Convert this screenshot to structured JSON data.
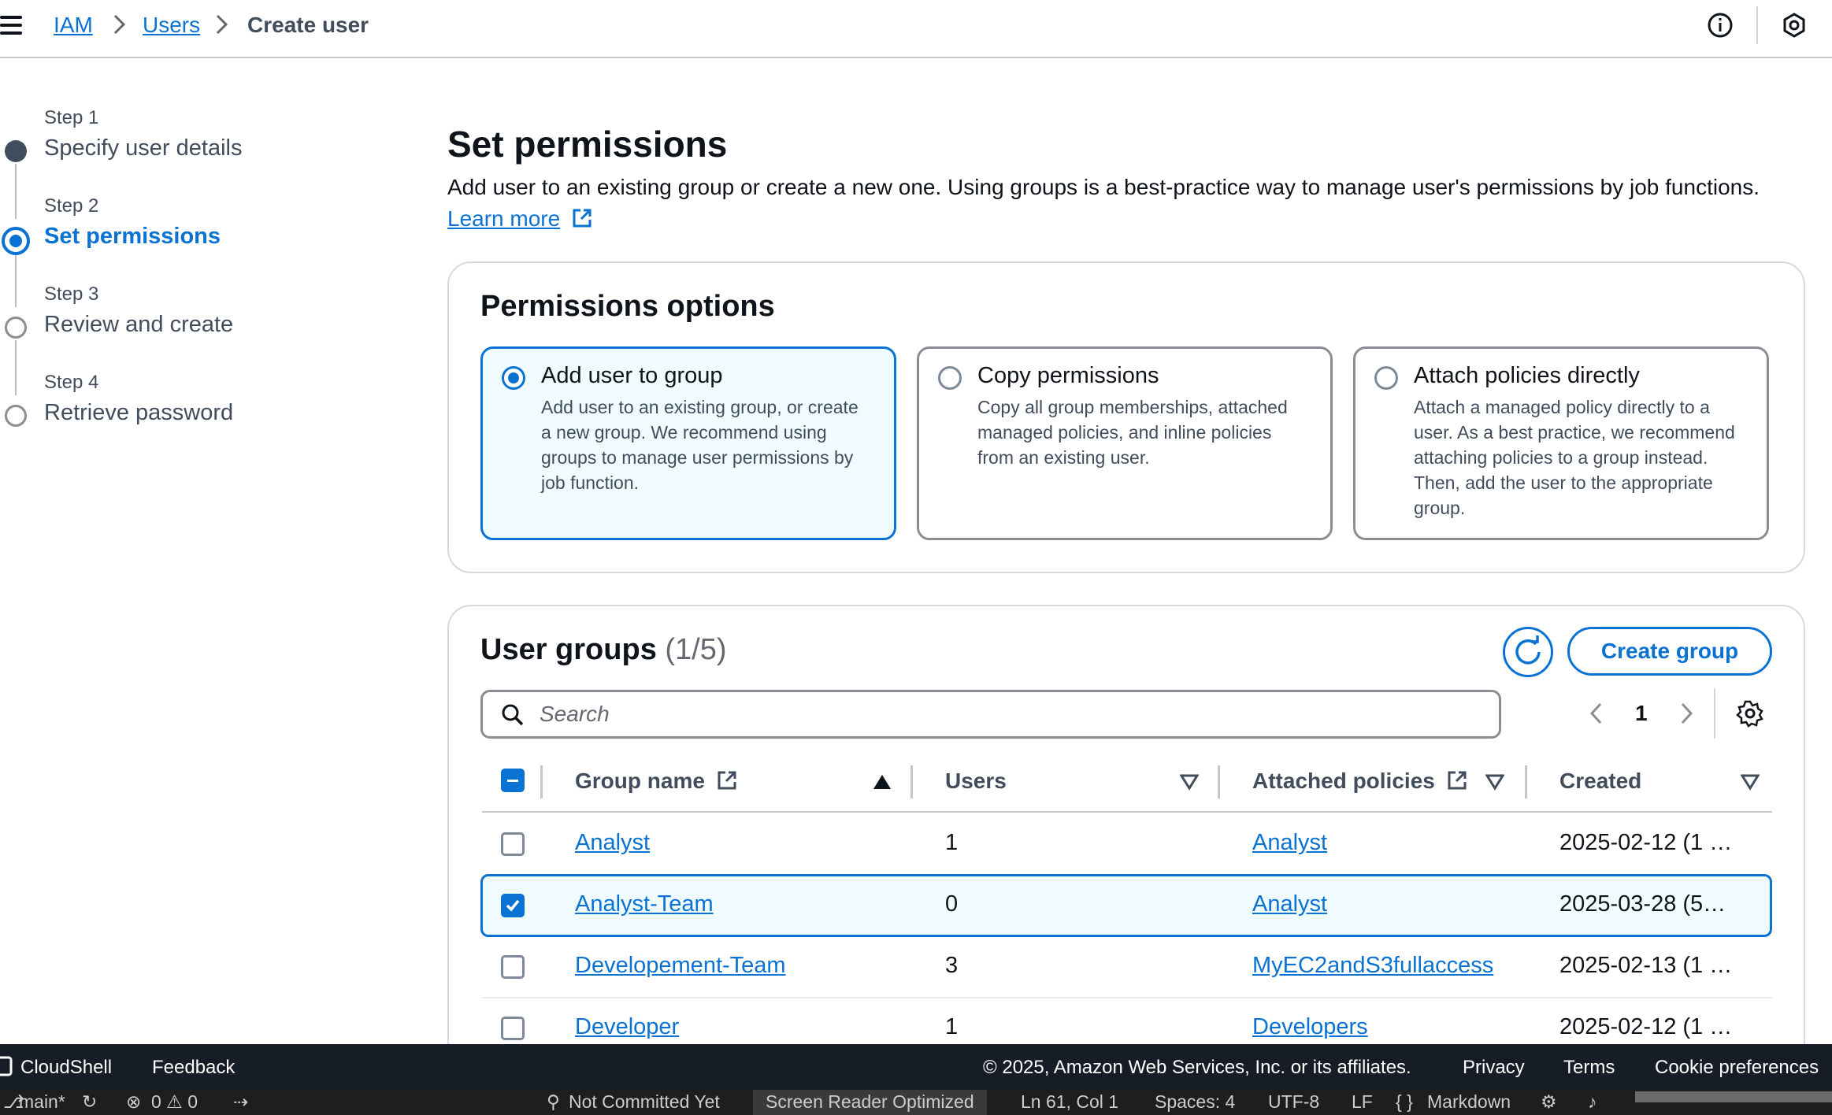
{
  "breadcrumb": {
    "items": [
      "IAM",
      "Users",
      "Create user"
    ]
  },
  "steps": [
    {
      "step": "Step 1",
      "label": "Specify user details"
    },
    {
      "step": "Step 2",
      "label": "Set permissions"
    },
    {
      "step": "Step 3",
      "label": "Review and create"
    },
    {
      "step": "Step 4",
      "label": "Retrieve password"
    }
  ],
  "page": {
    "title": "Set permissions",
    "description": "Add user to an existing group or create a new one. Using groups is a best-practice way to manage user's permissions by job functions.",
    "learn_more": "Learn more"
  },
  "permissions": {
    "title": "Permissions options",
    "options": [
      {
        "title": "Add user to group",
        "desc": "Add user to an existing group, or create a new group. We recommend using groups to manage user permissions by job function.",
        "selected": true
      },
      {
        "title": "Copy permissions",
        "desc": "Copy all group memberships, attached managed policies, and inline policies from an existing user.",
        "selected": false
      },
      {
        "title": "Attach policies directly",
        "desc": "Attach a managed policy directly to a user. As a best practice, we recommend attaching policies to a group instead. Then, add the user to the appropriate group.",
        "selected": false
      }
    ]
  },
  "groups": {
    "title": "User groups",
    "count": "(1/5)",
    "create_label": "Create group",
    "search_placeholder": "Search",
    "page_number": "1",
    "columns": [
      "Group name",
      "Users",
      "Attached policies",
      "Created"
    ],
    "rows": [
      {
        "name": "Analyst",
        "users": "1",
        "policies": "Analyst",
        "created": "2025-02-12 (1 …",
        "checked": false
      },
      {
        "name": "Analyst-Team",
        "users": "0",
        "policies": "Analyst",
        "created": "2025-03-28 (5…",
        "checked": true
      },
      {
        "name": "Developement-Team",
        "users": "3",
        "policies": "MyEC2andS3fullaccess",
        "created": "2025-02-13 (1 …",
        "checked": false
      },
      {
        "name": "Developer",
        "users": "1",
        "policies": "Developers",
        "created": "2025-02-12 (1 …",
        "checked": false
      }
    ]
  },
  "footer": {
    "cloudshell": "CloudShell",
    "feedback": "Feedback",
    "copyright": "© 2025, Amazon Web Services, Inc. or its affiliates.",
    "privacy": "Privacy",
    "terms": "Terms",
    "cookies": "Cookie preferences"
  },
  "statusbar": {
    "branch": "main*",
    "problems": "0 ⚠ 0",
    "commit": "Not Committed Yet",
    "screen_reader": "Screen Reader Optimized",
    "position": "Ln 61, Col 1",
    "spaces": "Spaces: 4",
    "encoding": "UTF-8",
    "eol": "LF",
    "language": "Markdown"
  },
  "colors": {
    "accent": "#0972d3",
    "footer_bg": "#161d26"
  }
}
